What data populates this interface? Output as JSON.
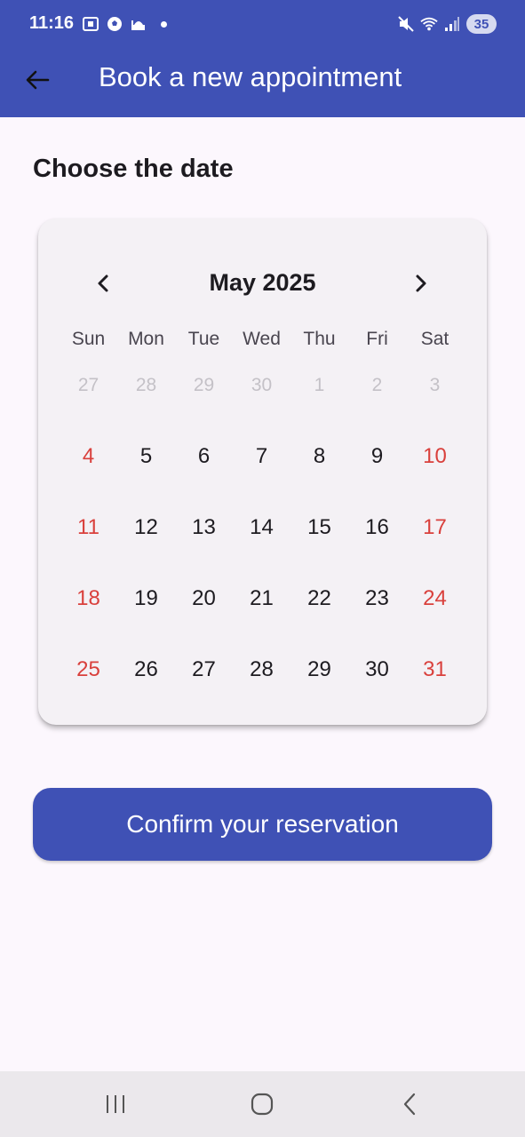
{
  "status_bar": {
    "time": "11:16",
    "battery": "35",
    "icons_left": [
      "screenshot-icon",
      "soccer-ball-icon",
      "mosque-icon",
      "notification-dot"
    ],
    "icons_right": [
      "mute-icon",
      "wifi-icon",
      "signal-icon",
      "battery-icon"
    ]
  },
  "app_bar": {
    "title": "Book a new appointment",
    "back_icon": "arrow-left-icon",
    "color": "#3f51b5"
  },
  "section_title": "Choose the date",
  "calendar": {
    "month_label": "May 2025",
    "prev_icon": "chevron-left-icon",
    "next_icon": "chevron-right-icon",
    "weekdays": [
      "Sun",
      "Mon",
      "Tue",
      "Wed",
      "Thu",
      "Fri",
      "Sat"
    ],
    "weeks": [
      [
        {
          "day": "27",
          "state": "muted"
        },
        {
          "day": "28",
          "state": "muted"
        },
        {
          "day": "29",
          "state": "muted"
        },
        {
          "day": "30",
          "state": "muted"
        },
        {
          "day": "1",
          "state": "muted"
        },
        {
          "day": "2",
          "state": "muted"
        },
        {
          "day": "3",
          "state": "muted"
        }
      ],
      [
        {
          "day": "4",
          "state": "weekend"
        },
        {
          "day": "5",
          "state": "normal"
        },
        {
          "day": "6",
          "state": "normal"
        },
        {
          "day": "7",
          "state": "normal"
        },
        {
          "day": "8",
          "state": "normal"
        },
        {
          "day": "9",
          "state": "normal"
        },
        {
          "day": "10",
          "state": "weekend"
        }
      ],
      [
        {
          "day": "11",
          "state": "weekend"
        },
        {
          "day": "12",
          "state": "normal"
        },
        {
          "day": "13",
          "state": "normal"
        },
        {
          "day": "14",
          "state": "normal"
        },
        {
          "day": "15",
          "state": "normal"
        },
        {
          "day": "16",
          "state": "normal"
        },
        {
          "day": "17",
          "state": "weekend"
        }
      ],
      [
        {
          "day": "18",
          "state": "weekend"
        },
        {
          "day": "19",
          "state": "normal"
        },
        {
          "day": "20",
          "state": "normal"
        },
        {
          "day": "21",
          "state": "normal"
        },
        {
          "day": "22",
          "state": "normal"
        },
        {
          "day": "23",
          "state": "normal"
        },
        {
          "day": "24",
          "state": "weekend"
        }
      ],
      [
        {
          "day": "25",
          "state": "weekend"
        },
        {
          "day": "26",
          "state": "normal"
        },
        {
          "day": "27",
          "state": "normal"
        },
        {
          "day": "28",
          "state": "normal"
        },
        {
          "day": "29",
          "state": "normal"
        },
        {
          "day": "30",
          "state": "normal"
        },
        {
          "day": "31",
          "state": "weekend"
        }
      ]
    ],
    "colors": {
      "weekend": "#d9403c",
      "muted": "#c4c1c7",
      "normal": "#1d1b20"
    }
  },
  "confirm_button": {
    "label": "Confirm your reservation"
  },
  "nav_bar": {
    "items": [
      "recent-apps-icon",
      "home-icon",
      "back-icon"
    ]
  }
}
